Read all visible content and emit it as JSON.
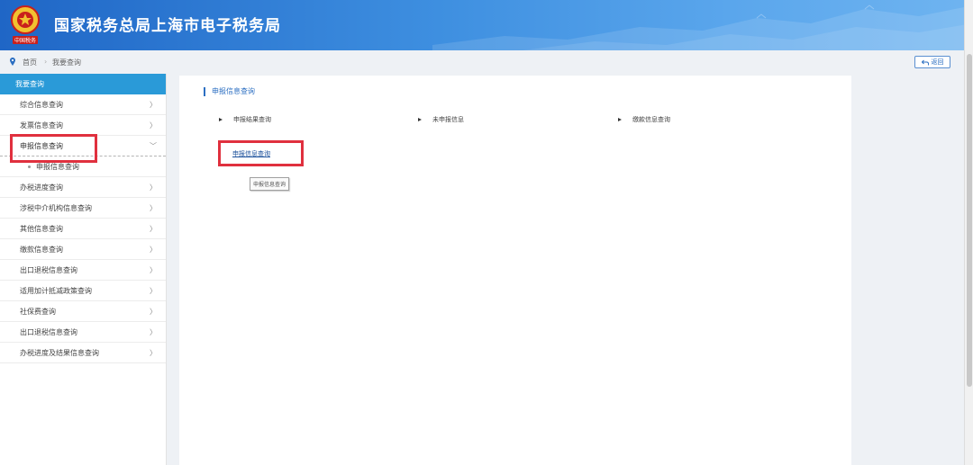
{
  "header": {
    "title": "国家税务总局上海市电子税务局",
    "emblem_text": "中国税务"
  },
  "breadcrumb": {
    "home": "首页",
    "separator": "›",
    "current": "我要查询"
  },
  "back_button": {
    "label": "返回"
  },
  "sidebar": {
    "title": "我要查询",
    "items": [
      {
        "label": "综合信息查询",
        "chevron": "〉"
      },
      {
        "label": "发票信息查询",
        "chevron": "〉"
      },
      {
        "label": "申报信息查询",
        "chevron": "﹀",
        "active": true
      },
      {
        "label": "申报信息查询",
        "sub": true
      },
      {
        "label": "办税进度查询",
        "chevron": "〉"
      },
      {
        "label": "涉税中介机构信息查询",
        "chevron": "〉"
      },
      {
        "label": "其他信息查询",
        "chevron": "〉"
      },
      {
        "label": "缴款信息查询",
        "chevron": "〉"
      },
      {
        "label": "出口退税信息查询",
        "chevron": "〉"
      },
      {
        "label": "适用加计抵减政策查询",
        "chevron": "〉"
      },
      {
        "label": "社保费查询",
        "chevron": "〉"
      },
      {
        "label": "出口退税信息查询",
        "chevron": "〉"
      },
      {
        "label": "办税进度及结果信息查询",
        "chevron": "〉"
      }
    ]
  },
  "main": {
    "section_title": "申报信息查询",
    "options": [
      "申报结果查询",
      "未申报信息",
      "缴款信息查询"
    ],
    "link": "申报信息查询",
    "tooltip": "申报信息查询"
  },
  "colors": {
    "header_blue": "#1f66c6",
    "sidebar_title_bg": "#2a9ad8",
    "highlight_red": "#e0303e",
    "link_blue": "#1a4f9a"
  }
}
